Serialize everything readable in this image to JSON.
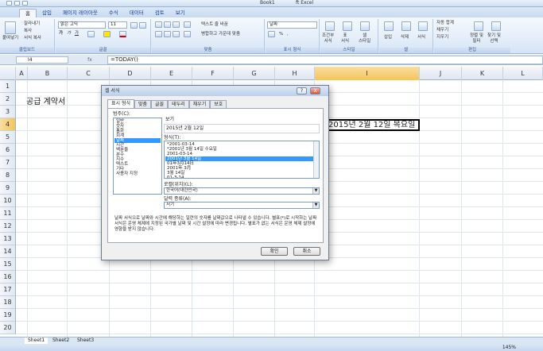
{
  "window": {
    "title_left": "Book1",
    "title_right": "ft Excel"
  },
  "ribbon_tabs": [
    "홈",
    "삽입",
    "페이지 레이아웃",
    "수식",
    "데이터",
    "검토",
    "보기"
  ],
  "ribbon": {
    "clipboard": {
      "paste": "붙여넣기",
      "cut": "잘라내기",
      "copy": "복사",
      "format_painter": "서식 복사",
      "label": "클립보드"
    },
    "font": {
      "name": "맑은 고딕",
      "size": "11",
      "bold": "가",
      "italic": "가",
      "underline": "가",
      "label": "글꼴"
    },
    "alignment": {
      "wrap": "텍스트 줄 바꿈",
      "merge": "병합하고 가운데 맞춤",
      "label": "맞춤"
    },
    "number": {
      "format": "날짜",
      "percent": "%",
      "comma": ",",
      "label": "표시 형식"
    },
    "styles": {
      "conditional": "조건부\n서식",
      "table": "표\n서식",
      "cell": "셀\n스타일",
      "label": "스타일"
    },
    "cells": {
      "insert": "삽입",
      "delete": "삭제",
      "format": "서식",
      "label": "셀"
    },
    "editing": {
      "autosum": "자동 합계",
      "fill": "채우기",
      "clear": "지우기",
      "sort": "정렬 및\n필터",
      "find": "찾기 및\n선택",
      "label": "편집"
    }
  },
  "formula_bar": {
    "cell_ref": "I4",
    "fx": "fx",
    "formula": "=TODAY()"
  },
  "grid": {
    "columns": [
      "A",
      "B",
      "C",
      "D",
      "E",
      "F",
      "G",
      "H",
      "I",
      "J",
      "K",
      "L"
    ],
    "selected_column": "I",
    "rows": [
      "1",
      "2",
      "3",
      "4",
      "5",
      "6",
      "7",
      "8",
      "9",
      "10",
      "11",
      "12",
      "13",
      "14",
      "15",
      "16",
      "17",
      "18",
      "19",
      "20"
    ],
    "selected_row": "4",
    "cell_B2": "공급 계약서",
    "cell_I4": "2015년 2월 12일 목요일"
  },
  "sheets": [
    "Sheet1",
    "Sheet2",
    "Sheet3"
  ],
  "status": {
    "zoom": "145%"
  },
  "dialog": {
    "title": "셀 서식",
    "help": "?",
    "close": "X",
    "tabs": [
      "표시 형식",
      "맞춤",
      "글꼴",
      "테두리",
      "채우기",
      "보호"
    ],
    "active_tab": "표시 형식",
    "category_label": "범주(C):",
    "categories": [
      "일반",
      "숫자",
      "통화",
      "회계",
      "날짜",
      "시간",
      "백분율",
      "분수",
      "지수",
      "텍스트",
      "기타",
      "사용자 지정"
    ],
    "selected_category": "날짜",
    "sample_label": "보기",
    "sample_value": "2015년 2월 12일",
    "type_label": "형식(T):",
    "types": [
      "*2001-03-14",
      "*2001년 3월 14일 수요일",
      "2001-03-14",
      "2001년 3월 14일",
      "01年3月14日",
      "2001年 3月",
      "3월 14일",
      "01-3-14"
    ],
    "selected_type": "2001년 3월 14일",
    "locale_label": "로캘(위치)(L):",
    "locale_value": "한국어(대한민국)",
    "calendar_label": "달력 종류(A):",
    "calendar_value": "서기",
    "description": "날짜 서식으로 날짜와 시간에 해당하는 일련의 숫자를 날짜값으로 나타낼 수 있습니다. 별표(*)로 시작하는 날짜 서식은 운영 체제에 지정된 국가별 날짜 및 시간 설정에 따라 변경됩니다. 별표가 없는 서식은 운영 체제 설정에 영향을 받지 않습니다.",
    "ok": "확인",
    "cancel": "취소"
  }
}
